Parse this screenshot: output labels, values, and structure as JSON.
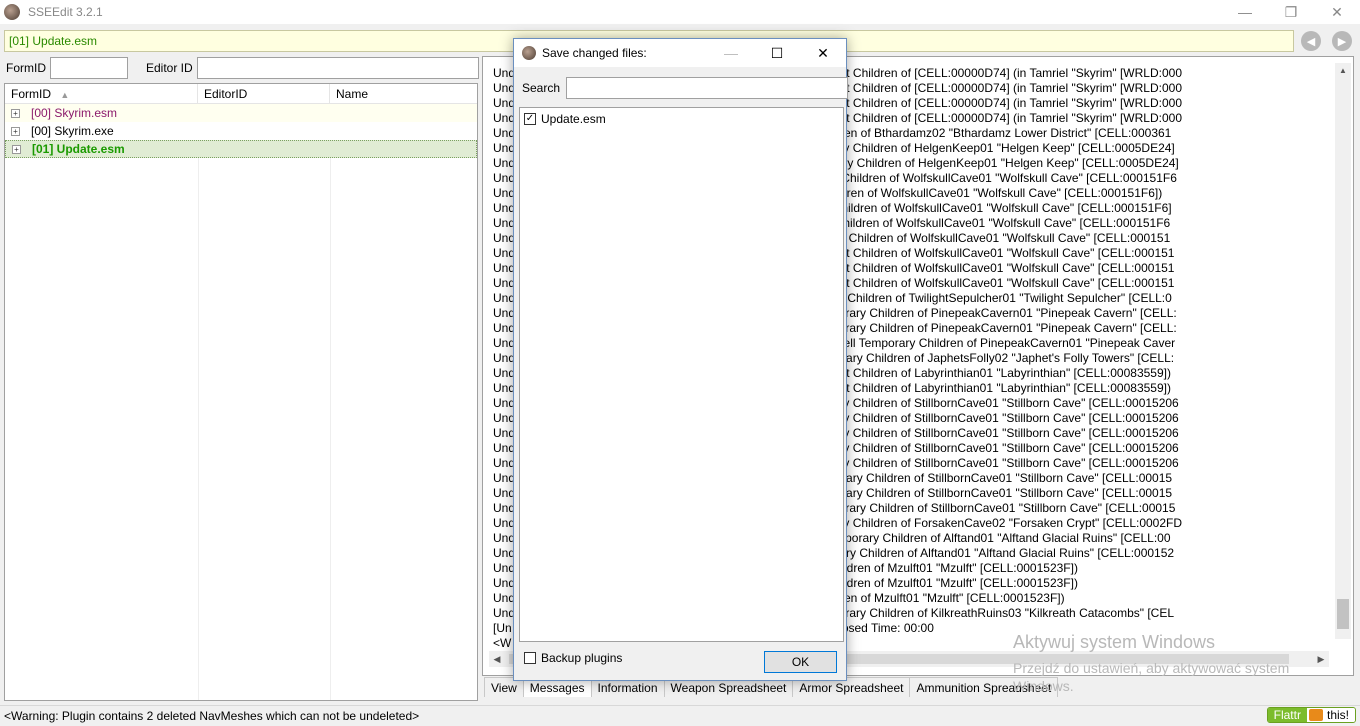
{
  "window": {
    "title": "SSEEdit 3.2.1",
    "minimize": "—",
    "maximize": "❐",
    "close": "✕"
  },
  "filter_bar": {
    "text": "[01] Update.esm",
    "back": "◀",
    "forward": "▶"
  },
  "left": {
    "formid_label": "FormID",
    "editorid_label": "Editor ID",
    "formid_value": "",
    "editorid_value": "",
    "columns": [
      "FormID",
      "EditorID",
      "Name"
    ],
    "sort_glyph": "▲",
    "rows": [
      {
        "label": "[00] Skyrim.esm",
        "color": "#8b1a6b",
        "bg": "#fffff0",
        "bold": false
      },
      {
        "label": "[00] Skyrim.exe",
        "color": "#000000",
        "bg": "#ffffff",
        "bold": false
      },
      {
        "label": "[01] Update.esm",
        "color": "#1a9a00",
        "bg": "#e0ecd4",
        "bold": true
      }
    ]
  },
  "log": {
    "lines": [
      "Und                                               0A00D4] in GRUP Cell Persistent Children of [CELL:00000D74] (in Tamriel \"Skyrim\" [WRLD:000",
      "Und                                               0A00D4] in GRUP Cell Persistent Children of [CELL:00000D74] (in Tamriel \"Skyrim\" [WRLD:000",
      "Und                                               0A00D4] in GRUP Cell Persistent Children of [CELL:00000D74] (in Tamriel \"Skyrim\" [WRLD:000",
      "Und                                               0A00D4] in GRUP Cell Persistent Children of [CELL:00000D74] (in Tamriel \"Skyrim\" [WRLD:000",
      "Und                                               ] in GRUP Cell Temporary Children of Bthardamz02 \"Bthardamz Lower District\" [CELL:000361",
      "Und                                               016441] in GRUP Cell Temporary Children of HelgenKeep01 \"Helgen Keep\" [CELL:0005DE24]",
      "Und                                               02EB0E] in GRUP Cell Temporary Children of HelgenKeep01 \"Helgen Keep\" [CELL:0005DE24]",
      "Und                                               286D] in GRUP Cell Temporary Children of WolfskullCave01 \"Wolfskull Cave\" [CELL:000151F6",
      "Und                                               9] in GRUP Cell Temporary Children of WolfskullCave01 \"Wolfskull Cave\" [CELL:000151F6])",
      "Und                                               875] in GRUP Cell Temporary Children of WolfskullCave01 \"Wolfskull Cave\" [CELL:000151F6]",
      "Und                                               86D] in GRUP Cell Temporary Children of WolfskullCave01 \"Wolfskull Cave\" [CELL:000151F6",
      "Und                                               A731D] in GRUP Cell Temporary Children of WolfskullCave01 \"Wolfskull Cave\" [CELL:000151",
      "Und                                               0A00D4] in GRUP Cell Persistent Children of WolfskullCave01 \"Wolfskull Cave\" [CELL:000151",
      "Und                                               0A00D4] in GRUP Cell Persistent Children of WolfskullCave01 \"Wolfskull Cave\" [CELL:000151",
      "Und                                               0A00D4] in GRUP Cell Persistent Children of WolfskullCave01 \"Wolfskull Cave\" [CELL:000151",
      "Und                                               455FF] in GRUP Cell Temporary Children of TwilightSepulcher01 \"Twilight Sepulcher\" [CELL:0",
      "Und                                               :00077777] in GRUP Cell Temporary Children of PinepeakCavern01 \"Pinepeak Cavern\" [CELL:",
      "Und                                               :00077777] in GRUP Cell Temporary Children of PinepeakCavern01 \"Pinepeak Cavern\" [CELL:",
      "Und                                               4 [MSTT:000A6C1E] in GRUP Cell Temporary Children of PinepeakCavern01 \"Pinepeak Caver",
      "Und                                               00030091] in GRUP Cell Temporary Children of JaphetsFolly02 \"Japhet's Folly Towers\" [CELL:",
      "Und                                               0A00D4] in GRUP Cell Persistent Children of Labyrinthian01 \"Labyrinthian\" [CELL:00083559])",
      "Und                                               0A00D4] in GRUP Cell Persistent Children of Labyrinthian01 \"Labyrinthian\" [CELL:00083559])",
      "Und                                               016441] in GRUP Cell Temporary Children of StillbornCave01 \"Stillborn Cave\" [CELL:00015206",
      "Und                                               016441] in GRUP Cell Temporary Children of StillbornCave01 \"Stillborn Cave\" [CELL:00015206",
      "Und                                               016441] in GRUP Cell Temporary Children of StillbornCave01 \"Stillborn Cave\" [CELL:00015206",
      "Und                                               016441] in GRUP Cell Temporary Children of StillbornCave01 \"Stillborn Cave\" [CELL:00015206",
      "Und                                               016441] in GRUP Cell Temporary Children of StillbornCave01 \"Stillborn Cave\" [CELL:00015206",
      "Und                                               00077777] in GRUP Cell Temporary Children of StillbornCave01 \"Stillborn Cave\" [CELL:00015",
      "Und                                               00077777] in GRUP Cell Temporary Children of StillbornCave01 \"Stillborn Cave\" [CELL:00015",
      "Und                                               :00077777] in GRUP Cell Temporary Children of StillbornCave01 \"Stillborn Cave\" [CELL:00015",
      "Und                                               000032] in GRUP Cell Temporary Children of ForsakenCave02 \"Forsaken Crypt\" [CELL:0002FD",
      "Und                                               TT:00016440] in GRUP Cell Temporary Children of Alftand01 \"Alftand Glacial Ruins\" [CELL:00",
      "Und                                               0077773] in GRUP Cell Temporary Children of Alftand01 \"Alftand Glacial Ruins\" [CELL:000152",
      "Und                                               30] in GRUP Cell Temporary Children of Mzulft01 \"Mzulft\" [CELL:0001523F])",
      "Und                                               30] in GRUP Cell Temporary Children of Mzulft01 \"Mzulft\" [CELL:0001523F])",
      "Und                                               ] in GRUP Cell Temporary Children of Mzulft01 \"Mzulft\" [CELL:0001523F])",
      "Und                                               :00077777] in GRUP Cell Temporary Children of KilkreathRuins03 \"Kilkreath Catacombs\" [CEL",
      "[Un                                               405, Undeleted Records: 91, Elapsed Time: 00:00",
      "<W                                               undeleted>"
    ]
  },
  "tabs": [
    "View",
    "Messages",
    "Information",
    "Weapon Spreadsheet",
    "Armor Spreadsheet",
    "Ammunition Spreadsheet"
  ],
  "active_tab": "Messages",
  "watermark": {
    "line1": "Aktywuj system Windows",
    "line2": "Przejdź do ustawień, aby aktywować system Windows."
  },
  "statusbar": {
    "text": "<Warning: Plugin contains 2 deleted NavMeshes which can not be undeleted>"
  },
  "flattr": {
    "label": "Flattr",
    "action": "this!"
  },
  "dialog": {
    "title": "Save changed files:",
    "search_label": "Search",
    "search_value": "",
    "items": [
      {
        "label": "Update.esm",
        "checked": true
      }
    ],
    "backup_label": "Backup plugins",
    "backup_checked": false,
    "ok_label": "OK",
    "minimize": "—",
    "maximize": "☐",
    "close": "✕"
  }
}
